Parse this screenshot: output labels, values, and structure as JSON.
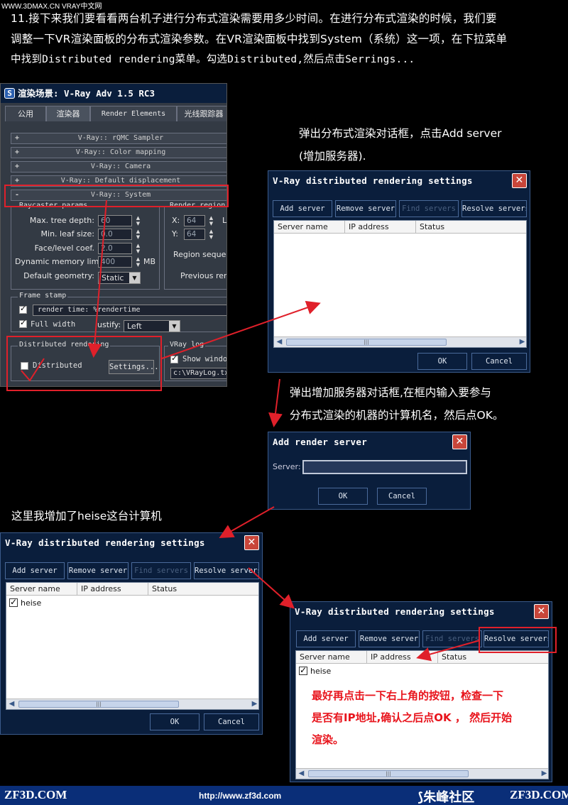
{
  "header": {
    "site_tag": "WWW.3DMAX.CN VRAY中文网",
    "intro_line1": "11.接下来我们要看看两台机子进行分布式渲染需要用多少时间。在进行分布式渲染的时候，我们要",
    "intro_line2": "调整一下VR渲染面板的分布式渲染参数。在VR渲染面板中找到System（系统）这一项，在下拉菜单",
    "intro_line3": "中找到Distributed rendering菜单。勾选Distributed,然后点击Serrings..."
  },
  "render_panel": {
    "title": "渲染场景: V-Ray Adv 1.5 RC3",
    "tabs": [
      "公用",
      "渲染器",
      "Render Elements",
      "光线跟踪器"
    ],
    "rollouts": [
      {
        "sign": "+",
        "label": "V-Ray:: rQMC Sampler"
      },
      {
        "sign": "+",
        "label": "V-Ray:: Color mapping"
      },
      {
        "sign": "+",
        "label": "V-Ray:: Camera"
      },
      {
        "sign": "+",
        "label": "V-Ray:: Default displacement"
      },
      {
        "sign": "-",
        "label": "V-Ray:: System"
      }
    ],
    "raycaster_group": "Raycaster params",
    "render_region_group": "Render region",
    "max_tree_depth_label": "Max. tree depth:",
    "max_tree_depth": "60",
    "min_leaf_size_label": "Min. leaf size:",
    "min_leaf_size": "0.0",
    "face_level_coef_label": "Face/level coef.",
    "face_level_coef": "2.0",
    "dynamic_memory_label": "Dynamic memory limit:",
    "dynamic_memory": "400",
    "dynamic_memory_unit": "MB",
    "default_geometry_label": "Default geometry:",
    "default_geometry": "Static",
    "region_x_label": "X:",
    "region_x": "64",
    "region_y_label": "Y:",
    "region_y": "64",
    "region_l": "L",
    "region_sequence_label": "Region sequenc",
    "previous_render_label": "Previous rend",
    "frame_stamp_group": "Frame stamp",
    "frame_stamp_text": "render time: %rendertime",
    "full_width_label": "Full width",
    "justify_label": "ustify:",
    "justify_value": "Left",
    "distributed_group": "Distributed rendering",
    "distributed_label": "Distributed",
    "settings_button": "Settings...",
    "vray_log_group": "VRay log",
    "show_window_label": "Show window",
    "log_path": "c:\\VRayLog.txt"
  },
  "note1": {
    "line1": "弹出分布式渲染对话框，点击Add server",
    "line2": "(增加服务器)."
  },
  "dr_dialog_1": {
    "title": "V-Ray distributed rendering settings",
    "close": "✕",
    "buttons": [
      "Add server",
      "Remove server",
      "Find servers",
      "Resolve servers"
    ],
    "columns": [
      "Server name",
      "IP address",
      "Status"
    ],
    "ok": "OK",
    "cancel": "Cancel"
  },
  "note2": {
    "line1": "弹出增加服务器对话框,在框内输入要参与",
    "line2": "分布式渲染的机器的计算机名，然后点OK。"
  },
  "add_server_dialog": {
    "title": "Add render server",
    "close": "✕",
    "server_label": "Server:",
    "server_value": "",
    "ok": "OK",
    "cancel": "Cancel"
  },
  "note3": "这里我增加了heise这台计算机",
  "dr_dialog_2": {
    "title": "V-Ray distributed rendering settings",
    "close": "✕",
    "buttons": [
      "Add server",
      "Remove server",
      "Find servers",
      "Resolve servers"
    ],
    "columns": [
      "Server name",
      "IP address",
      "Status"
    ],
    "rows": [
      {
        "name": "heise",
        "checked": true
      }
    ],
    "ok": "OK",
    "cancel": "Cancel"
  },
  "dr_dialog_3": {
    "title": "V-Ray distributed rendering settings",
    "close": "✕",
    "buttons": [
      "Add server",
      "Remove server",
      "Find servers",
      "Resolve servers"
    ],
    "columns": [
      "Server name",
      "IP address",
      "Status"
    ],
    "rows": [
      {
        "name": "heise",
        "checked": true
      }
    ],
    "note_line1": "最好再点击一下右上角的按钮，检查一下",
    "note_line2": "是否有IP地址,确认之后点OK ， 然后开始",
    "note_line3": "渲染。"
  },
  "footer": {
    "left_brand": "ZF3D.COM",
    "url": "http://www.zf3d.com",
    "community": "朱峰社区",
    "right_brand": "ZF3D.COM"
  },
  "colors": {
    "window_title_bg": "#0a1e3c",
    "close_button": "#c8463a",
    "annotation_red": "#e0202a",
    "footer_bg": "#0a2e78"
  }
}
